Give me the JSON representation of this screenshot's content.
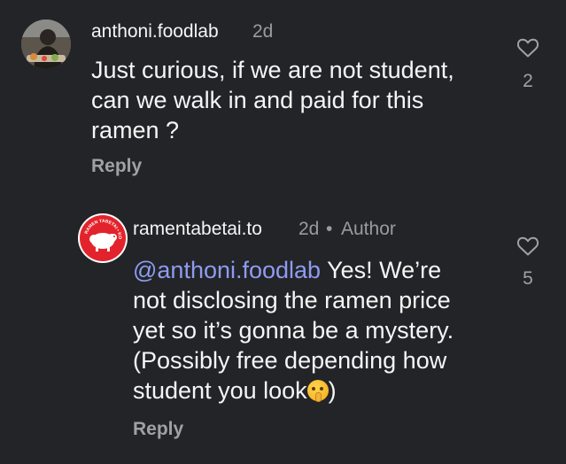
{
  "comments": [
    {
      "username": "anthoni.foodlab",
      "time": "2d",
      "text": "Just curious, if we are not student,\ncan we walk in and paid for this\nramen ?",
      "reply_label": "Reply",
      "likes": "2",
      "avatar_icon": "user-photo"
    },
    {
      "username": "ramentabetai.to",
      "time": "2d",
      "separator": "•",
      "badge": "Author",
      "mention": "@anthoni.foodlab",
      "text_after_mention": " Yes! We’re\nnot disclosing the ramen price\nyet so it’s gonna be a mystery.\n(Possibly free depending how\nstudent you look",
      "emoji": "shushing-face",
      "text_end": ")",
      "reply_label": "Reply",
      "likes": "5",
      "avatar_icon": "sheep-logo",
      "avatar_logo_text": "RAMEN TABETAI • KOMMA",
      "brand_color": "#e3232b"
    }
  ],
  "colors": {
    "background": "#232428",
    "mention": "#8e9cf0",
    "muted": "#9a9ba0"
  }
}
